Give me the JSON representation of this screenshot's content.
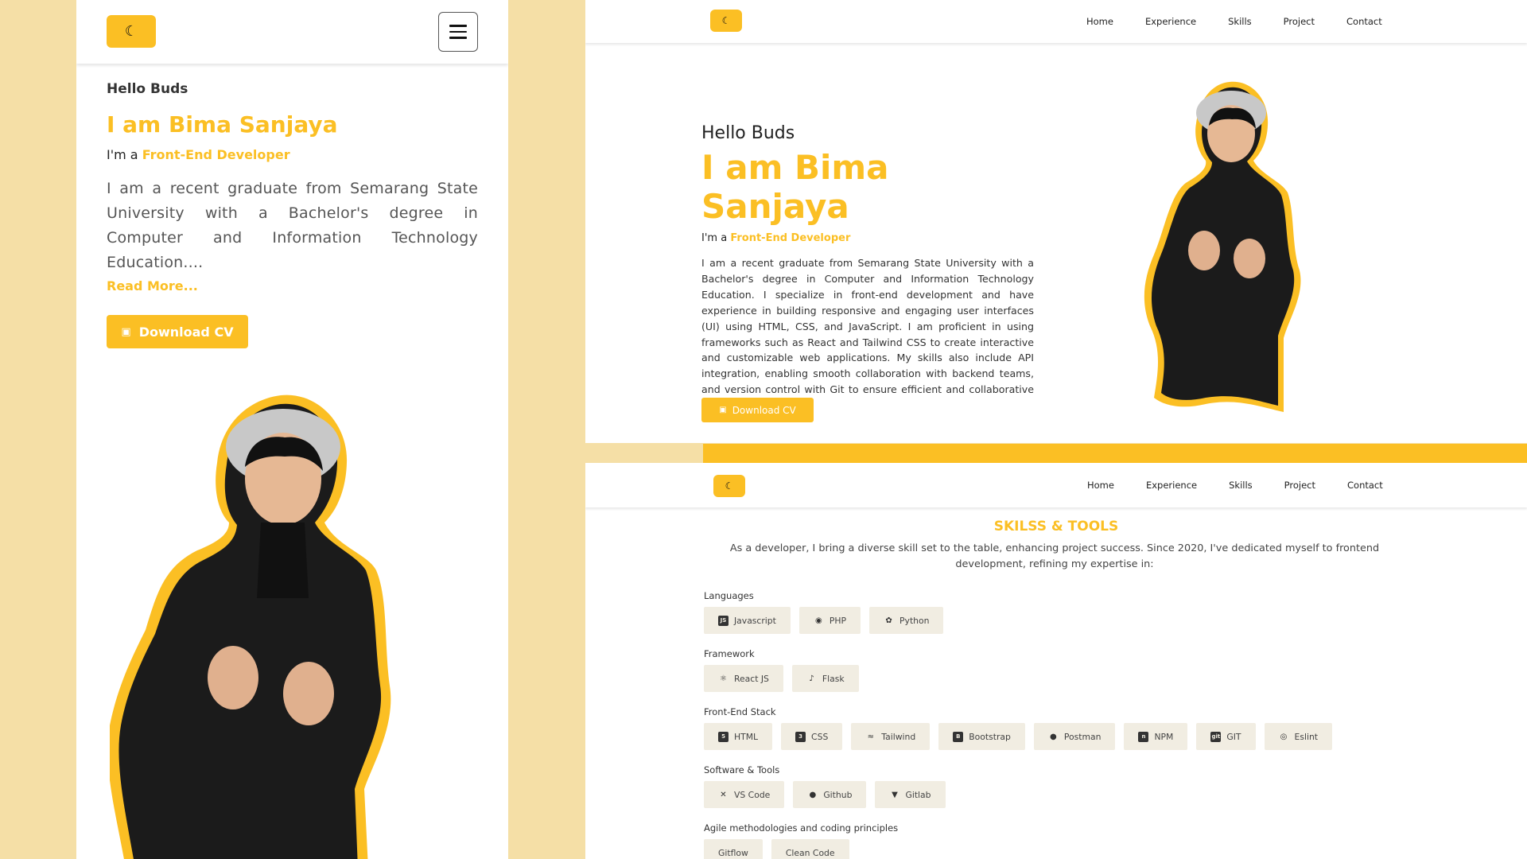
{
  "mobile": {
    "greeting": "Hello Buds",
    "name": "I am Bima Sanjaya",
    "role_prefix": "I'm a",
    "role": "Front-End Developer",
    "description": "I am a recent graduate from Semarang State University with a Bachelor's degree in Computer and Information Technology Education....",
    "read_more": "Read More...",
    "download_label": "Download CV"
  },
  "hero": {
    "nav": [
      "Home",
      "Experience",
      "Skills",
      "Project",
      "Contact"
    ],
    "greeting": "Hello Buds",
    "name": "I am Bima Sanjaya",
    "role_prefix": "I'm a",
    "role": "Front-End Developer",
    "description": "I am a recent graduate from Semarang State University with a Bachelor's degree in Computer and Information Technology Education. I specialize in front-end development and have experience in building responsive and engaging user interfaces (UI) using HTML, CSS, and JavaScript. I am proficient in using frameworks such as React and Tailwind CSS to create interactive and customizable web applications. My skills also include API integration, enabling smooth collaboration with backend teams, and version control with Git to ensure efficient and collaborative project development.",
    "download_label": "Download CV"
  },
  "skills": {
    "nav": [
      "Home",
      "Experience",
      "Skills",
      "Project",
      "Contact"
    ],
    "title": "SKILSS & TOOLS",
    "intro": "As a developer, I bring a diverse skill set to the table, enhancing project success. Since 2020, I've dedicated myself to frontend development, refining my expertise in:",
    "categories": [
      {
        "label": "Languages",
        "items": [
          {
            "name": "Javascript",
            "icon": "js-icon"
          },
          {
            "name": "PHP",
            "icon": "php-icon"
          },
          {
            "name": "Python",
            "icon": "python-icon"
          }
        ]
      },
      {
        "label": "Framework",
        "items": [
          {
            "name": "React JS",
            "icon": "react-icon"
          },
          {
            "name": "Flask",
            "icon": "flask-icon"
          }
        ]
      },
      {
        "label": "Front-End Stack",
        "items": [
          {
            "name": "HTML",
            "icon": "html5-icon"
          },
          {
            "name": "CSS",
            "icon": "css3-icon"
          },
          {
            "name": "Tailwind",
            "icon": "tailwind-icon"
          },
          {
            "name": "Bootstrap",
            "icon": "bootstrap-icon"
          },
          {
            "name": "Postman",
            "icon": "postman-icon"
          },
          {
            "name": "NPM",
            "icon": "npm-icon"
          },
          {
            "name": "GIT",
            "icon": "git-icon"
          },
          {
            "name": "Eslint",
            "icon": "eslint-icon"
          }
        ]
      },
      {
        "label": "Software & Tools",
        "items": [
          {
            "name": "VS Code",
            "icon": "vscode-icon"
          },
          {
            "name": "Github",
            "icon": "github-icon"
          },
          {
            "name": "Gitlab",
            "icon": "gitlab-icon"
          }
        ]
      },
      {
        "label": "Agile methodologies and coding principles",
        "items": [
          {
            "name": "Gitflow",
            "icon": ""
          },
          {
            "name": "Clean Code",
            "icon": ""
          }
        ]
      }
    ]
  },
  "colors": {
    "accent": "#fbbf24",
    "background": "#f5dfa6",
    "chip": "#f1ede2"
  }
}
